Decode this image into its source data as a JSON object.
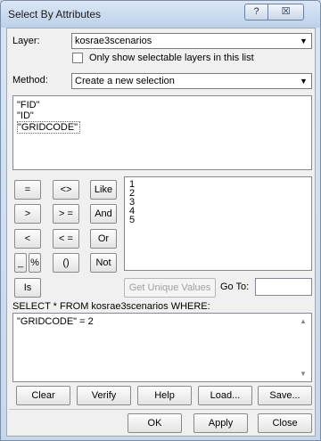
{
  "window": {
    "title": "Select By Attributes",
    "help_glyph": "?",
    "close_glyph": "☒"
  },
  "layer": {
    "label": "Layer:",
    "value": "kosrae3scenarios",
    "only_selectable_label": "Only show selectable layers in this list",
    "only_selectable_checked": false
  },
  "method": {
    "label": "Method:",
    "value": "Create a new selection"
  },
  "fields": [
    "\"FID\"",
    "\"ID\"",
    "\"GRIDCODE\""
  ],
  "selected_field_index": 2,
  "operators": {
    "equals": "=",
    "not_equal": "<>",
    "like": "Like",
    "greater": ">",
    "greater_equal": "> =",
    "and": "And",
    "less": "<",
    "less_equal": "< =",
    "or": "Or",
    "underscore": "_",
    "percent": "%",
    "parens": "()",
    "not": "Not",
    "is": "Is"
  },
  "unique_values": [
    "1",
    "2",
    "3",
    "4",
    "5"
  ],
  "get_unique_values_label": "Get Unique Values",
  "go_to_label": "Go To:",
  "go_to_value": "",
  "sql_prefix": "SELECT * FROM kosrae3scenarios WHERE:",
  "expression": "\"GRIDCODE\" = 2",
  "buttons": {
    "clear": "Clear",
    "verify": "Verify",
    "help": "Help",
    "load": "Load...",
    "save": "Save...",
    "ok": "OK",
    "apply": "Apply",
    "close": "Close"
  }
}
